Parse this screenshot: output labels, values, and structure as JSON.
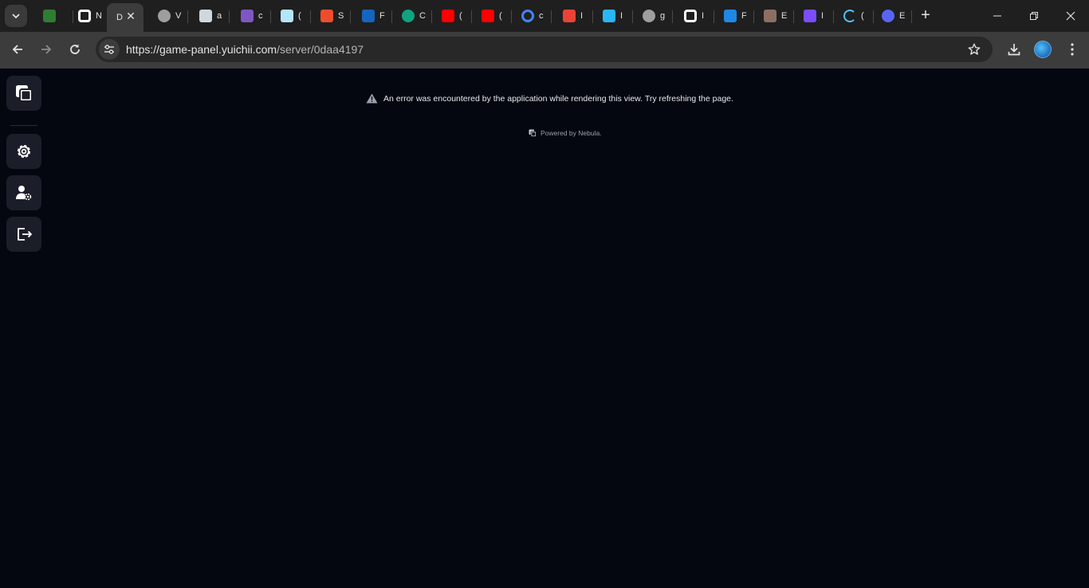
{
  "browser": {
    "tabs": [
      {
        "title": "",
        "icon": "leaf-icon",
        "color": "#2e7d32"
      },
      {
        "title": "N",
        "icon": "nebula-icon",
        "color": "#ffffff"
      },
      {
        "title": "D",
        "icon": "none",
        "color": "#3c3c3c",
        "active": true
      },
      {
        "title": "V",
        "icon": "globe-icon",
        "color": "#9e9e9e"
      },
      {
        "title": "a",
        "icon": "avatar-icon",
        "color": "#cfd8dc"
      },
      {
        "title": "c",
        "icon": "a-logo-icon",
        "color": "#7e57c2"
      },
      {
        "title": "(",
        "icon": "cube-icon",
        "color": "#b3e5fc"
      },
      {
        "title": "S",
        "icon": "shopee-icon",
        "color": "#ee4d2d"
      },
      {
        "title": "F",
        "icon": "paypal-icon",
        "color": "#1565c0"
      },
      {
        "title": "C",
        "icon": "openai-icon",
        "color": "#10a37f"
      },
      {
        "title": "(",
        "icon": "youtube-icon",
        "color": "#ff0000"
      },
      {
        "title": "(",
        "icon": "youtube-icon",
        "color": "#ff0000"
      },
      {
        "title": "c",
        "icon": "google-icon",
        "color": "#ffffff"
      },
      {
        "title": "I",
        "icon": "gmail-icon",
        "color": "#ea4335"
      },
      {
        "title": "I",
        "icon": "box-icon",
        "color": "#29b6f6"
      },
      {
        "title": "g",
        "icon": "globe-icon",
        "color": "#9e9e9e"
      },
      {
        "title": "I",
        "icon": "nebula-icon",
        "color": "#ffffff"
      },
      {
        "title": "F",
        "icon": "dollar-icon",
        "color": "#1e88e5"
      },
      {
        "title": "E",
        "icon": "character-icon",
        "color": "#8d6e63"
      },
      {
        "title": "I",
        "icon": "slash-icon",
        "color": "#7c4dff"
      },
      {
        "title": "(",
        "icon": "loading-icon",
        "color": "#4fc3f7"
      },
      {
        "title": "E",
        "icon": "discord-icon",
        "color": "#5865f2"
      }
    ],
    "url_host": "https://game-panel.yuichii.com",
    "url_path": "/server/0daa4197"
  },
  "page": {
    "error_message": "An error was encountered by the application while rendering this view. Try refreshing the page.",
    "powered_by": "Powered by Nebula."
  },
  "sidebar": {
    "items": [
      {
        "name": "home",
        "icon": "nebula-logo-icon"
      },
      {
        "name": "settings",
        "icon": "gear-icon"
      },
      {
        "name": "account",
        "icon": "user-settings-icon"
      },
      {
        "name": "logout",
        "icon": "logout-icon"
      }
    ]
  }
}
